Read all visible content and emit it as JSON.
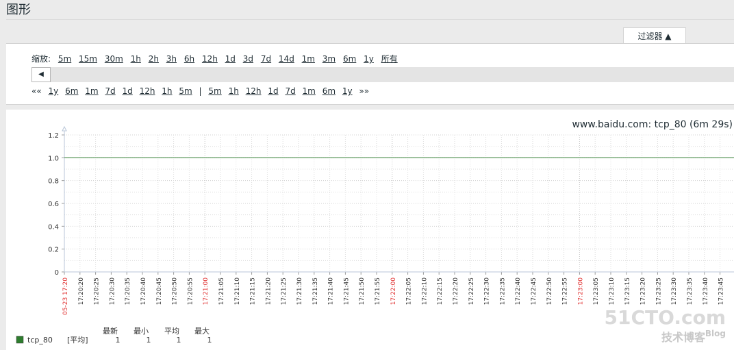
{
  "page_title": "图形",
  "filter_tab": {
    "label": "过滤器 ▲"
  },
  "zoom": {
    "label": "缩放:",
    "options": [
      "5m",
      "15m",
      "30m",
      "1h",
      "2h",
      "3h",
      "6h",
      "12h",
      "1d",
      "3d",
      "7d",
      "14d",
      "1m",
      "3m",
      "6m",
      "1y",
      "所有"
    ]
  },
  "slider": {
    "button": "◀"
  },
  "nav": {
    "back_all": "««",
    "back": [
      "1y",
      "6m",
      "1m",
      "7d",
      "1d",
      "12h",
      "1h",
      "5m"
    ],
    "separator": "|",
    "forward": [
      "5m",
      "1h",
      "12h",
      "1d",
      "7d",
      "1m",
      "6m",
      "1y"
    ],
    "forward_all": "»»"
  },
  "graph": {
    "title": "www.baidu.com: tcp_80 (6m 29s)"
  },
  "legend": {
    "headers": [
      "最新",
      "最小",
      "平均",
      "最大"
    ],
    "item_name": "tcp_80",
    "item_func": "[平均]",
    "values": [
      "1",
      "1",
      "1",
      "1"
    ],
    "color": "#2e7d2e"
  },
  "watermark": {
    "line1": "51CTO.com",
    "line2": "技术博客",
    "line3": "Blog"
  },
  "chart_data": {
    "type": "line",
    "title": "www.baidu.com: tcp_80 (6m 29s)",
    "ylim": [
      0,
      1.2
    ],
    "yticks": [
      "0",
      "0.2",
      "0.4",
      "0.6",
      "0.8",
      "1.0",
      "1.2"
    ],
    "xticks": [
      {
        "label": "05-23 17:20",
        "major": true
      },
      {
        "label": "17:20:20"
      },
      {
        "label": "17:20:25"
      },
      {
        "label": "17:20:30"
      },
      {
        "label": "17:20:35"
      },
      {
        "label": "17:20:40"
      },
      {
        "label": "17:20:45"
      },
      {
        "label": "17:20:50"
      },
      {
        "label": "17:20:55"
      },
      {
        "label": "17:21:00",
        "major": true
      },
      {
        "label": "17:21:05"
      },
      {
        "label": "17:21:10"
      },
      {
        "label": "17:21:15"
      },
      {
        "label": "17:21:20"
      },
      {
        "label": "17:21:25"
      },
      {
        "label": "17:21:30"
      },
      {
        "label": "17:21:35"
      },
      {
        "label": "17:21:40"
      },
      {
        "label": "17:21:45"
      },
      {
        "label": "17:21:50"
      },
      {
        "label": "17:21:55"
      },
      {
        "label": "17:22:00",
        "major": true
      },
      {
        "label": "17:22:05"
      },
      {
        "label": "17:22:10"
      },
      {
        "label": "17:22:15"
      },
      {
        "label": "17:22:20"
      },
      {
        "label": "17:22:25"
      },
      {
        "label": "17:22:30"
      },
      {
        "label": "17:22:35"
      },
      {
        "label": "17:22:40"
      },
      {
        "label": "17:22:45"
      },
      {
        "label": "17:22:50"
      },
      {
        "label": "17:22:55"
      },
      {
        "label": "17:23:00",
        "major": true
      },
      {
        "label": "17:23:05"
      },
      {
        "label": "17:23:10"
      },
      {
        "label": "17:23:15"
      },
      {
        "label": "17:23:20"
      },
      {
        "label": "17:23:25"
      },
      {
        "label": "17:23:30"
      },
      {
        "label": "17:23:35"
      },
      {
        "label": "17:23:40"
      },
      {
        "label": "17:23:45"
      }
    ],
    "series": [
      {
        "name": "tcp_80",
        "color": "#2e7d2e",
        "values": [
          1,
          1
        ]
      }
    ],
    "grid": true,
    "major_tick_color": "#e03030",
    "line_color": "#2e7d2e"
  }
}
